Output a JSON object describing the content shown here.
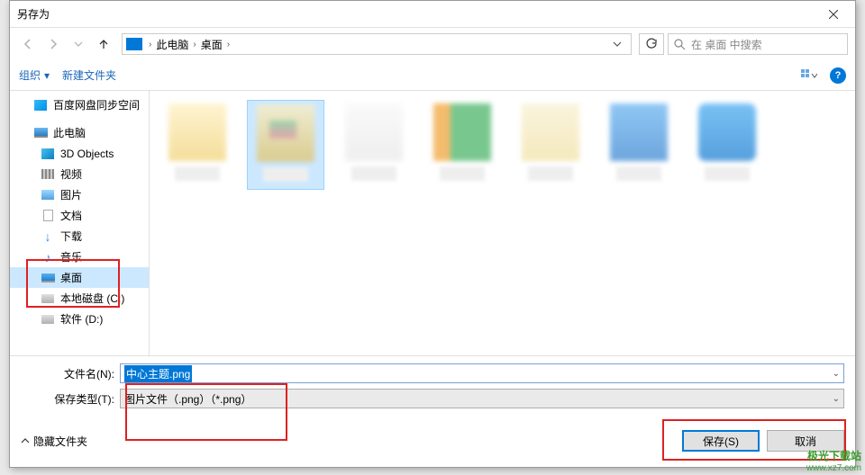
{
  "dialog": {
    "title": "另存为"
  },
  "breadcrumb": {
    "items": [
      "此电脑",
      "桌面"
    ]
  },
  "search": {
    "placeholder": "在 桌面 中搜索"
  },
  "toolbar": {
    "organize": "组织",
    "new_folder": "新建文件夹"
  },
  "sidebar": {
    "items": [
      {
        "label": "百度网盘同步空间",
        "icon": "ico-cube",
        "child": false
      },
      {
        "label": "此电脑",
        "icon": "ico-pc",
        "child": false
      },
      {
        "label": "3D Objects",
        "icon": "ico-3d",
        "child": true
      },
      {
        "label": "视频",
        "icon": "ico-video",
        "child": true
      },
      {
        "label": "图片",
        "icon": "ico-img",
        "child": true
      },
      {
        "label": "文档",
        "icon": "ico-doc",
        "child": true
      },
      {
        "label": "下载",
        "icon": "dl",
        "child": true
      },
      {
        "label": "音乐",
        "icon": "music",
        "child": true
      },
      {
        "label": "桌面",
        "icon": "ico-desk",
        "child": true,
        "selected": true
      },
      {
        "label": "本地磁盘 (C:)",
        "icon": "ico-disk",
        "child": true
      },
      {
        "label": "软件 (D:)",
        "icon": "ico-disk",
        "child": true
      }
    ]
  },
  "fields": {
    "filename_label": "文件名(N):",
    "filename_value": "中心主题.png",
    "filetype_label": "保存类型(T):",
    "filetype_value": "图片文件（.png）（*.png）"
  },
  "footer": {
    "hide_folders": "隐藏文件夹",
    "save": "保存(S)",
    "cancel": "取消"
  },
  "watermark": {
    "line1": "极光下载站",
    "line2": "www.xz7.com"
  }
}
